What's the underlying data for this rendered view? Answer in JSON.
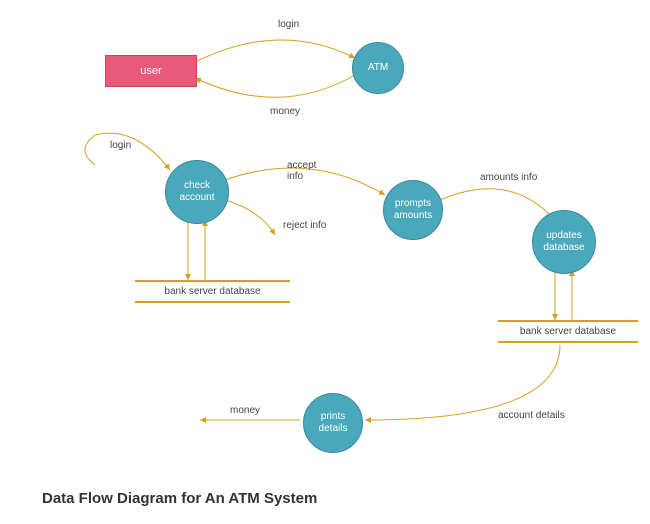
{
  "title": "Data Flow Diagram for An ATM System",
  "entities": {
    "user": "user"
  },
  "processes": {
    "atm": "ATM",
    "check_account": "check\naccount",
    "prompts_amounts": "prompts\namounts",
    "updates_database": "updates\ndatabase",
    "prints_details": "prints\ndetails"
  },
  "datastores": {
    "bank_server_db1": "bank server database",
    "bank_server_db2": "bank server database"
  },
  "flows": {
    "login1": "login",
    "money1": "money",
    "login2": "login",
    "accept_info": "accept\ninfo",
    "reject_info": "reject info",
    "amounts_info": "amounts info",
    "account_details": "account details",
    "money2": "money"
  }
}
